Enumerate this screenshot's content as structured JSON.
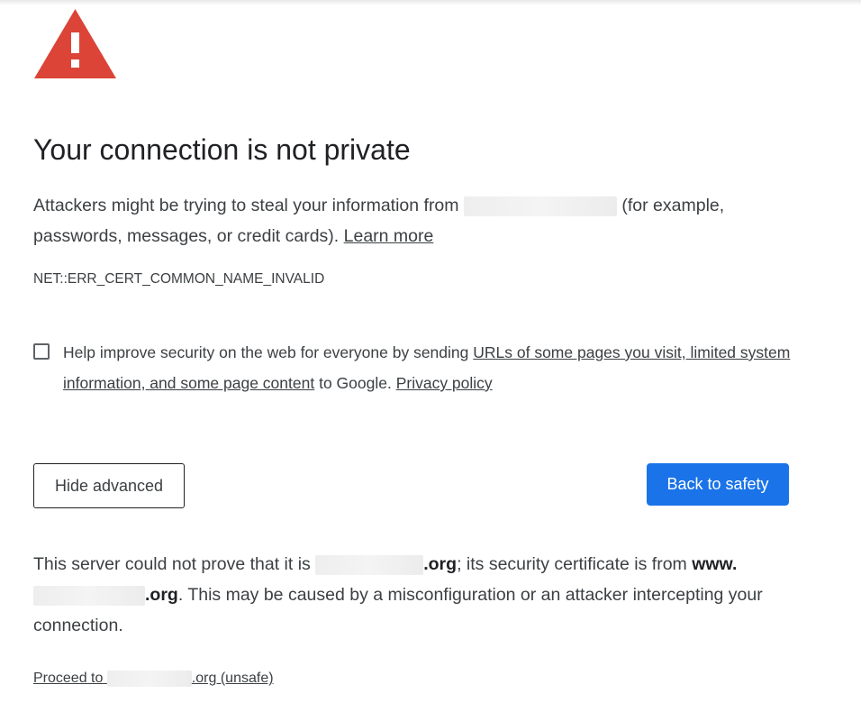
{
  "icon": {
    "name": "warning-triangle-icon",
    "color": "#db4437",
    "glyph": "!"
  },
  "title": "Your connection is not private",
  "intro": {
    "before": "Attackers might be trying to steal your information from",
    "after": " (for example, passwords, messages, or credit cards). ",
    "learn_more": "Learn more"
  },
  "error_code": "NET::ERR_CERT_COMMON_NAME_INVALID",
  "optin": {
    "checked": false,
    "before": "Help improve security on the web for everyone by sending ",
    "link": "URLs of some pages you visit, limited system information, and some page content",
    "middle": " to Google. ",
    "privacy": "Privacy policy"
  },
  "buttons": {
    "hide_advanced": "Hide advanced",
    "back_to_safety": "Back to safety",
    "primary_color": "#1a73e8"
  },
  "details": {
    "p1": "This server could not prove that it is ",
    "domain_suffix": ".org",
    "p2": "; its security certificate is from ",
    "cert_prefix": "www.",
    "cert_suffix": ".org",
    "p3": ". This may be caused by a misconfiguration or an attacker intercepting your connection."
  },
  "proceed": {
    "prefix": "Proceed to ",
    "suffix": ".org (unsafe)"
  }
}
